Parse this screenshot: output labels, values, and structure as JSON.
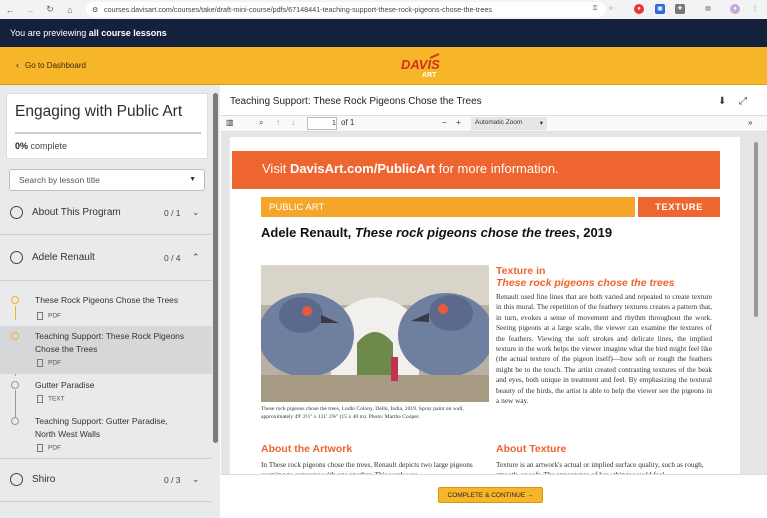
{
  "browser": {
    "url": "courses.davisart.com/courses/take/draft-mini-course/pdfs/67148441-teaching-support-these-rock-pigeons-chose-the-trees"
  },
  "preview_banner": {
    "prefix": "You are previewing ",
    "bold": "all course lessons"
  },
  "header": {
    "dashboard_label": "Go to Dashboard",
    "logo_text": "DAVIS",
    "logo_sub": "ART"
  },
  "course": {
    "title": "Engaging with Public Art",
    "progress_percent": "0%",
    "progress_suffix": " complete"
  },
  "search": {
    "placeholder": "Search by lesson title"
  },
  "modules": [
    {
      "title": "About This Program",
      "count": "0 / 1"
    },
    {
      "title": "Adele Renault",
      "count": "0 / 4"
    },
    {
      "title": "Shiro",
      "count": "0 / 3"
    }
  ],
  "lessons": [
    {
      "title": "These Rock Pigeons Chose the Trees",
      "type": "PDF"
    },
    {
      "title": "Teaching Support: These Rock Pigeons Chose the Trees",
      "type": "PDF"
    },
    {
      "title": "Gutter Paradise",
      "type": "TEXT"
    },
    {
      "title": "Teaching Support: Gutter Paradise, North West Walls",
      "type": "PDF"
    }
  ],
  "viewer": {
    "title": "Teaching Support: These Rock Pigeons Chose the Trees",
    "page_number": "1",
    "page_total": "of 1",
    "zoom": "Automatic Zoom"
  },
  "pdf": {
    "banner_pre": "Visit ",
    "banner_link": "DavisArt.com/PublicArt",
    "banner_post": " for more information.",
    "section": "PUBLIC ART",
    "tag": "TEXTURE",
    "heading_artist": "Adele Renault, ",
    "heading_title": "These rock pigeons chose the trees",
    "heading_year": ", 2019",
    "caption": "These rock pigeons chose the trees, Lodhi Colony, Delhi, India, 2019. Spray paint on wall, approximately 49′ 2½″ x 131′ 2⅝″ (15 x 40 m). Photo: Martha Cooper.",
    "texture_heading_1": "Texture in",
    "texture_heading_2": "These rock pigeons chose the trees",
    "texture_body": "Renault used fine lines that are both varied and repeated to create texture in this mural. The repetition of the feathery textures creates a pattern that, in turn, evokes a sense of movement and rhythm throughout the work. Seeing pigeons at a large scale, the viewer can examine the textures of the feathers. Viewing the soft strokes and delicate lines, the implied texture in the work helps the viewer imagine what the bird might feel like (the actual texture of the pigeon itself)—how soft or rough the feathers might be to the touch. The artist created contrasting textures of the beak and eyes, both unique in treatment and feel. By emphasizing the textural beauty of the birds, the artist is able to help the viewer see the pigeons in a new way.",
    "about_artwork_heading": "About the Artwork",
    "about_artwork_body": "In These rock pigeons chose the trees, Renault depicts two large pigeons seeming to converse with one another. This work was",
    "about_texture_heading": "About Texture",
    "about_texture_body": "Texture is an artwork's actual or implied surface quality, such as rough, smooth, or soft. The appearance of how things would feel"
  },
  "footer": {
    "continue_label": "COMPLETE & CONTINUE  →"
  },
  "colors": {
    "navy": "#14213d",
    "yellow": "#f7b52a",
    "orange": "#ee6530"
  }
}
